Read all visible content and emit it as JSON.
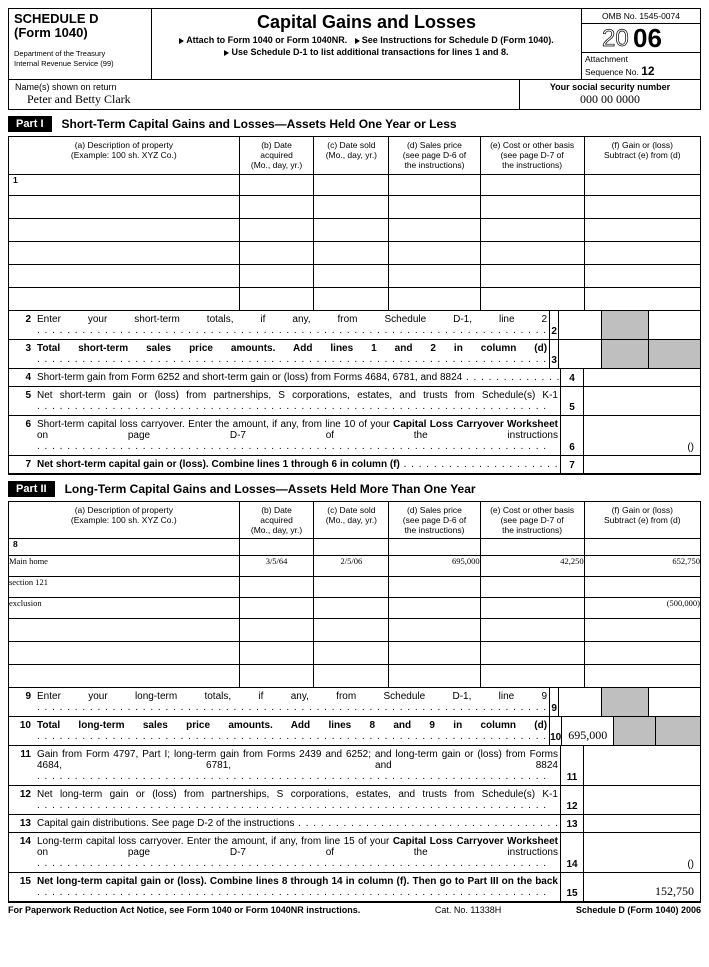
{
  "header": {
    "schedule": "SCHEDULE D",
    "form": "(Form 1040)",
    "dept": "Department of the Treasury",
    "irs": "Internal Revenue Service      (99)",
    "title": "Capital Gains and Losses",
    "sub1": "Attach to Form 1040 or Form 1040NR.",
    "sub2": "See Instructions for Schedule D (Form 1040).",
    "sub3": "Use Schedule D-1 to list additional transactions for lines 1 and 8.",
    "omb": "OMB No. 1545-0074",
    "year": "2006",
    "att": "Attachment",
    "seq": "Sequence No. ",
    "seqnum": "12"
  },
  "namesLabel": "Name(s) shown on return",
  "ssnLabel": "Your social security number",
  "name": "Peter and Betty Clark",
  "ssn": "000   00   0000",
  "part1": {
    "label": "Part I",
    "title": "Short-Term Capital Gains and Losses—Assets Held One Year or Less"
  },
  "cols": {
    "a": "(a) Description of property\n(Example: 100 sh. XYZ Co.)",
    "b": "(b) Date\nacquired\n(Mo., day, yr.)",
    "c": "(c) Date sold\n(Mo., day, yr.)",
    "d": "(d) Sales price\n(see page D-6 of\nthe instructions)",
    "e": "(e) Cost or other basis\n(see page D-7 of\nthe instructions)",
    "f": "(f) Gain or (loss)\nSubtract (e) from (d)"
  },
  "p1": {
    "rownum": "1",
    "l2": "Enter your short-term totals, if any, from Schedule D-1, line 2",
    "l3": "Total short-term sales price amounts. Add lines 1 and 2 in column (d)",
    "l4": "Short-term gain from Form 6252 and short-term gain or (loss) from Forms 4684, 6781, and 8824",
    "l5": "Net short-term gain or (loss) from partnerships, S corporations, estates, and trusts from Schedule(s) K-1",
    "l6": "Short-term capital loss carryover. Enter the amount, if any, from line 10 of your Capital Loss Carryover Worksheet on page D-7 of the instructions",
    "l7": "Net short-term capital gain or (loss). Combine lines 1 through 6 in column (f)"
  },
  "part2": {
    "label": "Part II",
    "title": "Long-Term Capital Gains and Losses—Assets Held More Than One Year"
  },
  "p2": {
    "rownum": "8",
    "rows": [
      {
        "a": "Main home",
        "b": "3/5/64",
        "c": "2/5/06",
        "d": "695,000",
        "e": "42,250",
        "f": "652,750"
      },
      {
        "a": "section 121",
        "b": "",
        "c": "",
        "d": "",
        "e": "",
        "f": ""
      },
      {
        "a": "exclusion",
        "b": "",
        "c": "",
        "d": "",
        "e": "",
        "f": "(500,000)"
      }
    ],
    "l9": "Enter your long-term totals, if any, from Schedule D-1, line 9",
    "l10": "Total long-term sales price amounts. Add lines 8 and 9 in column (d)",
    "l10v": "695,000",
    "l11": "Gain from Form 4797, Part I; long-term gain from Forms 2439 and 6252; and long-term gain or (loss) from Forms 4684, 6781, and 8824",
    "l12": "Net long-term gain or (loss) from partnerships, S corporations, estates, and trusts from Schedule(s) K-1",
    "l13": "Capital gain distributions. See page D-2 of the instructions",
    "l14": "Long-term capital loss carryover. Enter the amount, if any, from line 15 of your Capital Loss Carryover Worksheet on page D-7 of the instructions",
    "l15": "Net long-term capital gain or (loss). Combine lines 8 through 14 in column (f). Then go to Part III on the back",
    "l15v": "152,750"
  },
  "footer": {
    "l": "For Paperwork Reduction Act Notice, see Form 1040 or Form 1040NR instructions.",
    "c": "Cat. No. 11338H",
    "r": "Schedule D (Form 1040) 2006"
  }
}
